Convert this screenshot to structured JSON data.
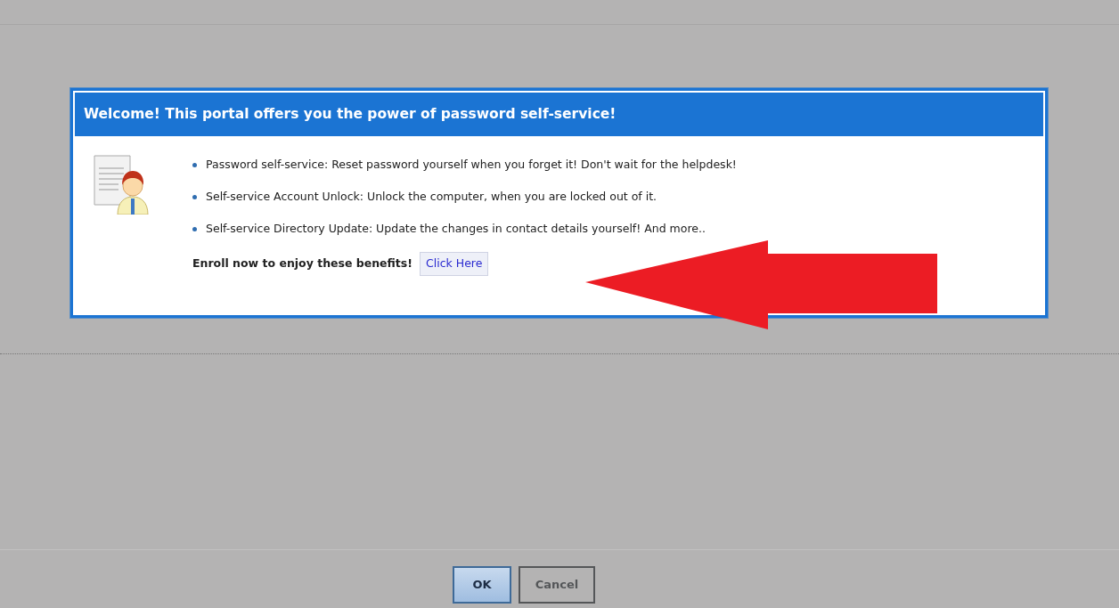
{
  "dialog": {
    "title": "Welcome! This portal offers you the power of password self-service!",
    "benefits": [
      "Password self-service: Reset password yourself when you forget it! Don't wait for the helpdesk!",
      "Self-service Account Unlock: Unlock the computer, when you are locked out of it.",
      "Self-service Directory Update: Update the changes in contact details yourself! And more.."
    ],
    "enroll_text": "Enroll now to enjoy these benefits!",
    "enroll_link": "Click Here"
  },
  "annotation": {
    "kind": "arrow"
  },
  "buttons": [
    {
      "label": "OK",
      "disabled": false
    },
    {
      "label": "Cancel",
      "disabled": true
    }
  ]
}
